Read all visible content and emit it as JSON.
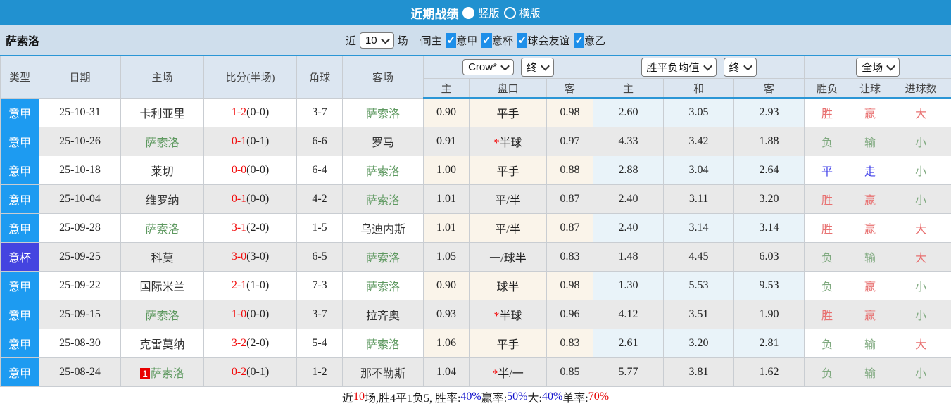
{
  "topbar": {
    "title": "近期战绩",
    "radios": [
      {
        "label": "竖版",
        "state": "sel",
        "selected": true
      },
      {
        "label": "横版",
        "state": "rdo",
        "selected": false
      }
    ]
  },
  "filterbar": {
    "team_name": "萨索洛",
    "near_label": "近",
    "matches_count": "10",
    "matches_label": "场",
    "checkboxes": [
      {
        "label": "同主",
        "state": "off",
        "mark": ""
      },
      {
        "label": "意甲",
        "state": "on",
        "mark": "✓"
      },
      {
        "label": "意杯",
        "state": "on",
        "mark": "✓"
      },
      {
        "label": "球会友谊",
        "state": "on",
        "mark": "✓"
      },
      {
        "label": "意乙",
        "state": "on",
        "mark": "✓"
      }
    ]
  },
  "icons": {
    "checkmark": "✓"
  },
  "colors": {
    "accent_blue": "#2191d0",
    "serie_a_badge": "#1d9bf1",
    "cup_badge": "#4444e0",
    "team_green": "#5e9960",
    "score_red": "#f20d0d",
    "win_red": "#e87070",
    "lose_green": "#7fa97f",
    "draw_blue": "#4040e8"
  },
  "table": {
    "main_headers": [
      "类型",
      "日期",
      "主场",
      "比分(半场)",
      "角球",
      "客场"
    ],
    "selects": {
      "bookmaker": "Crow*",
      "bookmaker_time": "终",
      "odds_avg": "胜平负均值",
      "odds_time": "终",
      "scope": "全场"
    },
    "sub_headers": [
      "主",
      "盘口",
      "客",
      "主",
      "和",
      "客",
      "胜负",
      "让球",
      "进球数"
    ],
    "rows": [
      {
        "league": "意甲",
        "league_style": "a",
        "date": "25-10-31",
        "home": "卡利亚里",
        "home_style": "plain",
        "home_badge": "",
        "score_ft": "1-2",
        "score_ht": "(0-0)",
        "corner": "3-7",
        "away": "萨索洛",
        "away_style": "green",
        "asia_home": "0.90",
        "handicap_star": "",
        "handicap": "平手",
        "asia_away": "0.98",
        "odds_home": "2.60",
        "odds_draw": "3.05",
        "odds_away": "2.93",
        "res_wl": "胜",
        "res_wl_style": "red",
        "res_let": "赢",
        "res_let_style": "red",
        "res_goal": "大",
        "res_goal_style": "red"
      },
      {
        "league": "意甲",
        "league_style": "a",
        "date": "25-10-26",
        "home": "萨索洛",
        "home_style": "green",
        "home_badge": "",
        "score_ft": "0-1",
        "score_ht": "(0-1)",
        "corner": "6-6",
        "away": "罗马",
        "away_style": "plain",
        "asia_home": "0.91",
        "handicap_star": "*",
        "handicap": "半球",
        "asia_away": "0.97",
        "odds_home": "4.33",
        "odds_draw": "3.42",
        "odds_away": "1.88",
        "res_wl": "负",
        "res_wl_style": "green",
        "res_let": "输",
        "res_let_style": "green",
        "res_goal": "小",
        "res_goal_style": "green"
      },
      {
        "league": "意甲",
        "league_style": "a",
        "date": "25-10-18",
        "home": "莱切",
        "home_style": "plain",
        "home_badge": "",
        "score_ft": "0-0",
        "score_ht": "(0-0)",
        "corner": "6-4",
        "away": "萨索洛",
        "away_style": "green",
        "asia_home": "1.00",
        "handicap_star": "",
        "handicap": "平手",
        "asia_away": "0.88",
        "odds_home": "2.88",
        "odds_draw": "3.04",
        "odds_away": "2.64",
        "res_wl": "平",
        "res_wl_style": "blue",
        "res_let": "走",
        "res_let_style": "blue",
        "res_goal": "小",
        "res_goal_style": "green"
      },
      {
        "league": "意甲",
        "league_style": "a",
        "date": "25-10-04",
        "home": "维罗纳",
        "home_style": "plain",
        "home_badge": "",
        "score_ft": "0-1",
        "score_ht": "(0-0)",
        "corner": "4-2",
        "away": "萨索洛",
        "away_style": "green",
        "asia_home": "1.01",
        "handicap_star": "",
        "handicap": "平/半",
        "asia_away": "0.87",
        "odds_home": "2.40",
        "odds_draw": "3.11",
        "odds_away": "3.20",
        "res_wl": "胜",
        "res_wl_style": "red",
        "res_let": "赢",
        "res_let_style": "red",
        "res_goal": "小",
        "res_goal_style": "green"
      },
      {
        "league": "意甲",
        "league_style": "a",
        "date": "25-09-28",
        "home": "萨索洛",
        "home_style": "green",
        "home_badge": "",
        "score_ft": "3-1",
        "score_ht": "(2-0)",
        "corner": "1-5",
        "away": "乌迪内斯",
        "away_style": "plain",
        "asia_home": "1.01",
        "handicap_star": "",
        "handicap": "平/半",
        "asia_away": "0.87",
        "odds_home": "2.40",
        "odds_draw": "3.14",
        "odds_away": "3.14",
        "res_wl": "胜",
        "res_wl_style": "red",
        "res_let": "赢",
        "res_let_style": "red",
        "res_goal": "大",
        "res_goal_style": "red"
      },
      {
        "league": "意杯",
        "league_style": "b",
        "date": "25-09-25",
        "home": "科莫",
        "home_style": "plain",
        "home_badge": "",
        "score_ft": "3-0",
        "score_ht": "(3-0)",
        "corner": "6-5",
        "away": "萨索洛",
        "away_style": "green",
        "asia_home": "1.05",
        "handicap_star": "",
        "handicap": "一/球半",
        "asia_away": "0.83",
        "odds_home": "1.48",
        "odds_draw": "4.45",
        "odds_away": "6.03",
        "res_wl": "负",
        "res_wl_style": "green",
        "res_let": "输",
        "res_let_style": "green",
        "res_goal": "大",
        "res_goal_style": "red"
      },
      {
        "league": "意甲",
        "league_style": "a",
        "date": "25-09-22",
        "home": "国际米兰",
        "home_style": "plain",
        "home_badge": "",
        "score_ft": "2-1",
        "score_ht": "(1-0)",
        "corner": "7-3",
        "away": "萨索洛",
        "away_style": "green",
        "asia_home": "0.90",
        "handicap_star": "",
        "handicap": "球半",
        "asia_away": "0.98",
        "odds_home": "1.30",
        "odds_draw": "5.53",
        "odds_away": "9.53",
        "res_wl": "负",
        "res_wl_style": "green",
        "res_let": "赢",
        "res_let_style": "red",
        "res_goal": "小",
        "res_goal_style": "green"
      },
      {
        "league": "意甲",
        "league_style": "a",
        "date": "25-09-15",
        "home": "萨索洛",
        "home_style": "green",
        "home_badge": "",
        "score_ft": "1-0",
        "score_ht": "(0-0)",
        "corner": "3-7",
        "away": "拉齐奥",
        "away_style": "plain",
        "asia_home": "0.93",
        "handicap_star": "*",
        "handicap": "半球",
        "asia_away": "0.96",
        "odds_home": "4.12",
        "odds_draw": "3.51",
        "odds_away": "1.90",
        "res_wl": "胜",
        "res_wl_style": "red",
        "res_let": "赢",
        "res_let_style": "red",
        "res_goal": "小",
        "res_goal_style": "green"
      },
      {
        "league": "意甲",
        "league_style": "a",
        "date": "25-08-30",
        "home": "克雷莫纳",
        "home_style": "plain",
        "home_badge": "",
        "score_ft": "3-2",
        "score_ht": "(2-0)",
        "corner": "5-4",
        "away": "萨索洛",
        "away_style": "green",
        "asia_home": "1.06",
        "handicap_star": "",
        "handicap": "平手",
        "asia_away": "0.83",
        "odds_home": "2.61",
        "odds_draw": "3.20",
        "odds_away": "2.81",
        "res_wl": "负",
        "res_wl_style": "green",
        "res_let": "输",
        "res_let_style": "green",
        "res_goal": "大",
        "res_goal_style": "red"
      },
      {
        "league": "意甲",
        "league_style": "a",
        "date": "25-08-24",
        "home": "萨索洛",
        "home_style": "green",
        "home_badge": "1",
        "score_ft": "0-2",
        "score_ht": "(0-1)",
        "corner": "1-2",
        "away": "那不勒斯",
        "away_style": "plain",
        "asia_home": "1.04",
        "handicap_star": "*",
        "handicap": "半/一",
        "asia_away": "0.85",
        "odds_home": "5.77",
        "odds_draw": "3.81",
        "odds_away": "1.62",
        "res_wl": "负",
        "res_wl_style": "green",
        "res_let": "输",
        "res_let_style": "green",
        "res_goal": "小",
        "res_goal_style": "green"
      }
    ]
  },
  "footer": {
    "near_label": "近",
    "near_count": "10",
    "mid": "场,胜4平1负5, 胜率:",
    "win_rate": "40%",
    "label_win2": " 赢率:",
    "win_rate2": "50%",
    "label_big": " 大:",
    "big_rate": "40%",
    "label_single": " 单率:",
    "single_rate": "70%"
  }
}
